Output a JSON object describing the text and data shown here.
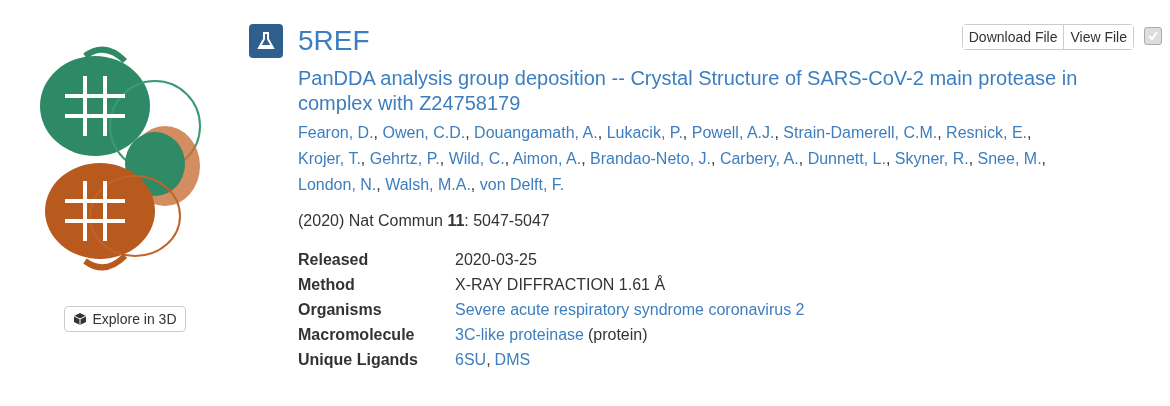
{
  "entry": {
    "id": "5REF",
    "title": "PanDDA analysis group deposition -- Crystal Structure of SARS-CoV-2 main protease in complex with Z24758179",
    "authors": [
      "Fearon, D.",
      "Owen, C.D.",
      "Douangamath, A.",
      "Lukacik, P.",
      "Powell, A.J.",
      "Strain-Damerell, C.M.",
      "Resnick, E.",
      "Krojer, T.",
      "Gehrtz, P.",
      "Wild, C.",
      "Aimon, A.",
      "Brandao-Neto, J.",
      "Carbery, A.",
      "Dunnett, L.",
      "Skyner, R.",
      "Snee, M.",
      "London, N.",
      "Walsh, M.A.",
      "von Delft, F."
    ],
    "author_separator": ",",
    "citation": "(2020) Nat Commun **11**: 5047-5047",
    "details": [
      {
        "label": "Released",
        "parts": [
          {
            "kind": "text",
            "text": "2020-03-25"
          }
        ]
      },
      {
        "label": "Method",
        "parts": [
          {
            "kind": "text",
            "text": "X-RAY DIFFRACTION 1.61 Å"
          }
        ]
      },
      {
        "label": "Organisms",
        "parts": [
          {
            "kind": "link",
            "text": "Severe acute respiratory syndrome coronavirus 2"
          }
        ]
      },
      {
        "label": "Macromolecule",
        "parts": [
          {
            "kind": "link",
            "text": "3C-like proteinase"
          },
          {
            "kind": "text",
            "text": "(protein)"
          }
        ]
      },
      {
        "label": "Unique Ligands",
        "parts": [
          {
            "kind": "link",
            "text": "6SU"
          },
          {
            "kind": "text",
            "text": ","
          },
          {
            "kind": "link",
            "text": "DMS"
          }
        ]
      }
    ]
  },
  "explore_button": "Explore in 3D",
  "file_buttons": [
    "Download File",
    "View File"
  ],
  "select_checkbox": {
    "checked": true,
    "disabled": true
  }
}
